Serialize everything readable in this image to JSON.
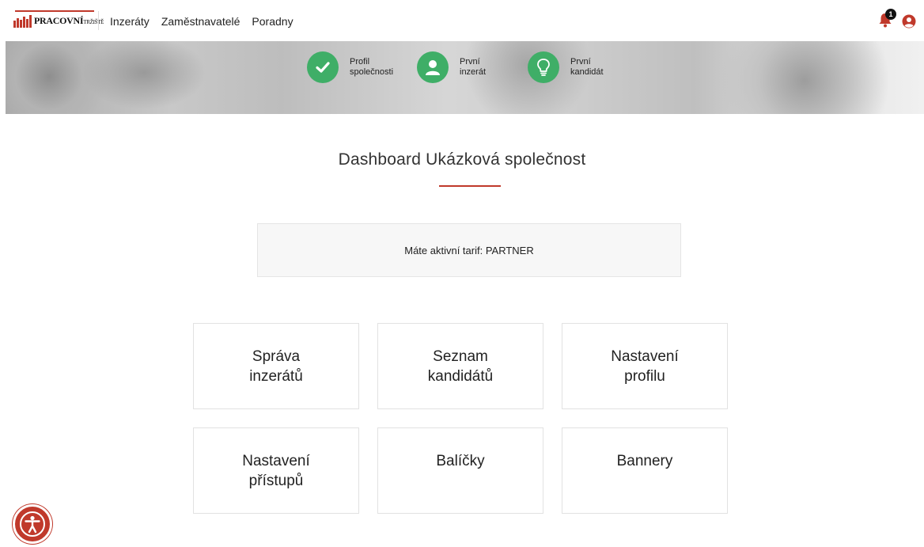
{
  "header": {
    "logo_text": "PRACOVNÍ",
    "logo_subtext": "TRŽIŠTĚ",
    "nav": [
      "Inzeráty",
      "Zaměstnavatelé",
      "Poradny"
    ],
    "notification_count": "1"
  },
  "progress": {
    "steps": [
      {
        "line1": "Profil",
        "line2": "společnosti",
        "icon": "check-icon",
        "done": true
      },
      {
        "line1": "První",
        "line2": "inzerát",
        "icon": "user-icon",
        "done": true
      },
      {
        "line1": "První",
        "line2": "kandidát",
        "icon": "lightbulb-icon",
        "done": true
      }
    ]
  },
  "page": {
    "title": "Dashboard Ukázková společnost",
    "tariff_text": "Máte aktivní tarif: PARTNER"
  },
  "tiles": [
    {
      "line1": "Správa",
      "line2": "inzerátů"
    },
    {
      "line1": "Seznam",
      "line2": "kandidátů"
    },
    {
      "line1": "Nastavení",
      "line2": "profilu"
    },
    {
      "line1": "Nastavení",
      "line2": "přístupů"
    },
    {
      "line1": "Balíčky",
      "line2": ""
    },
    {
      "line1": "Bannery",
      "line2": ""
    }
  ],
  "colors": {
    "accent": "#c0392b",
    "step_green": "#3fae67"
  }
}
